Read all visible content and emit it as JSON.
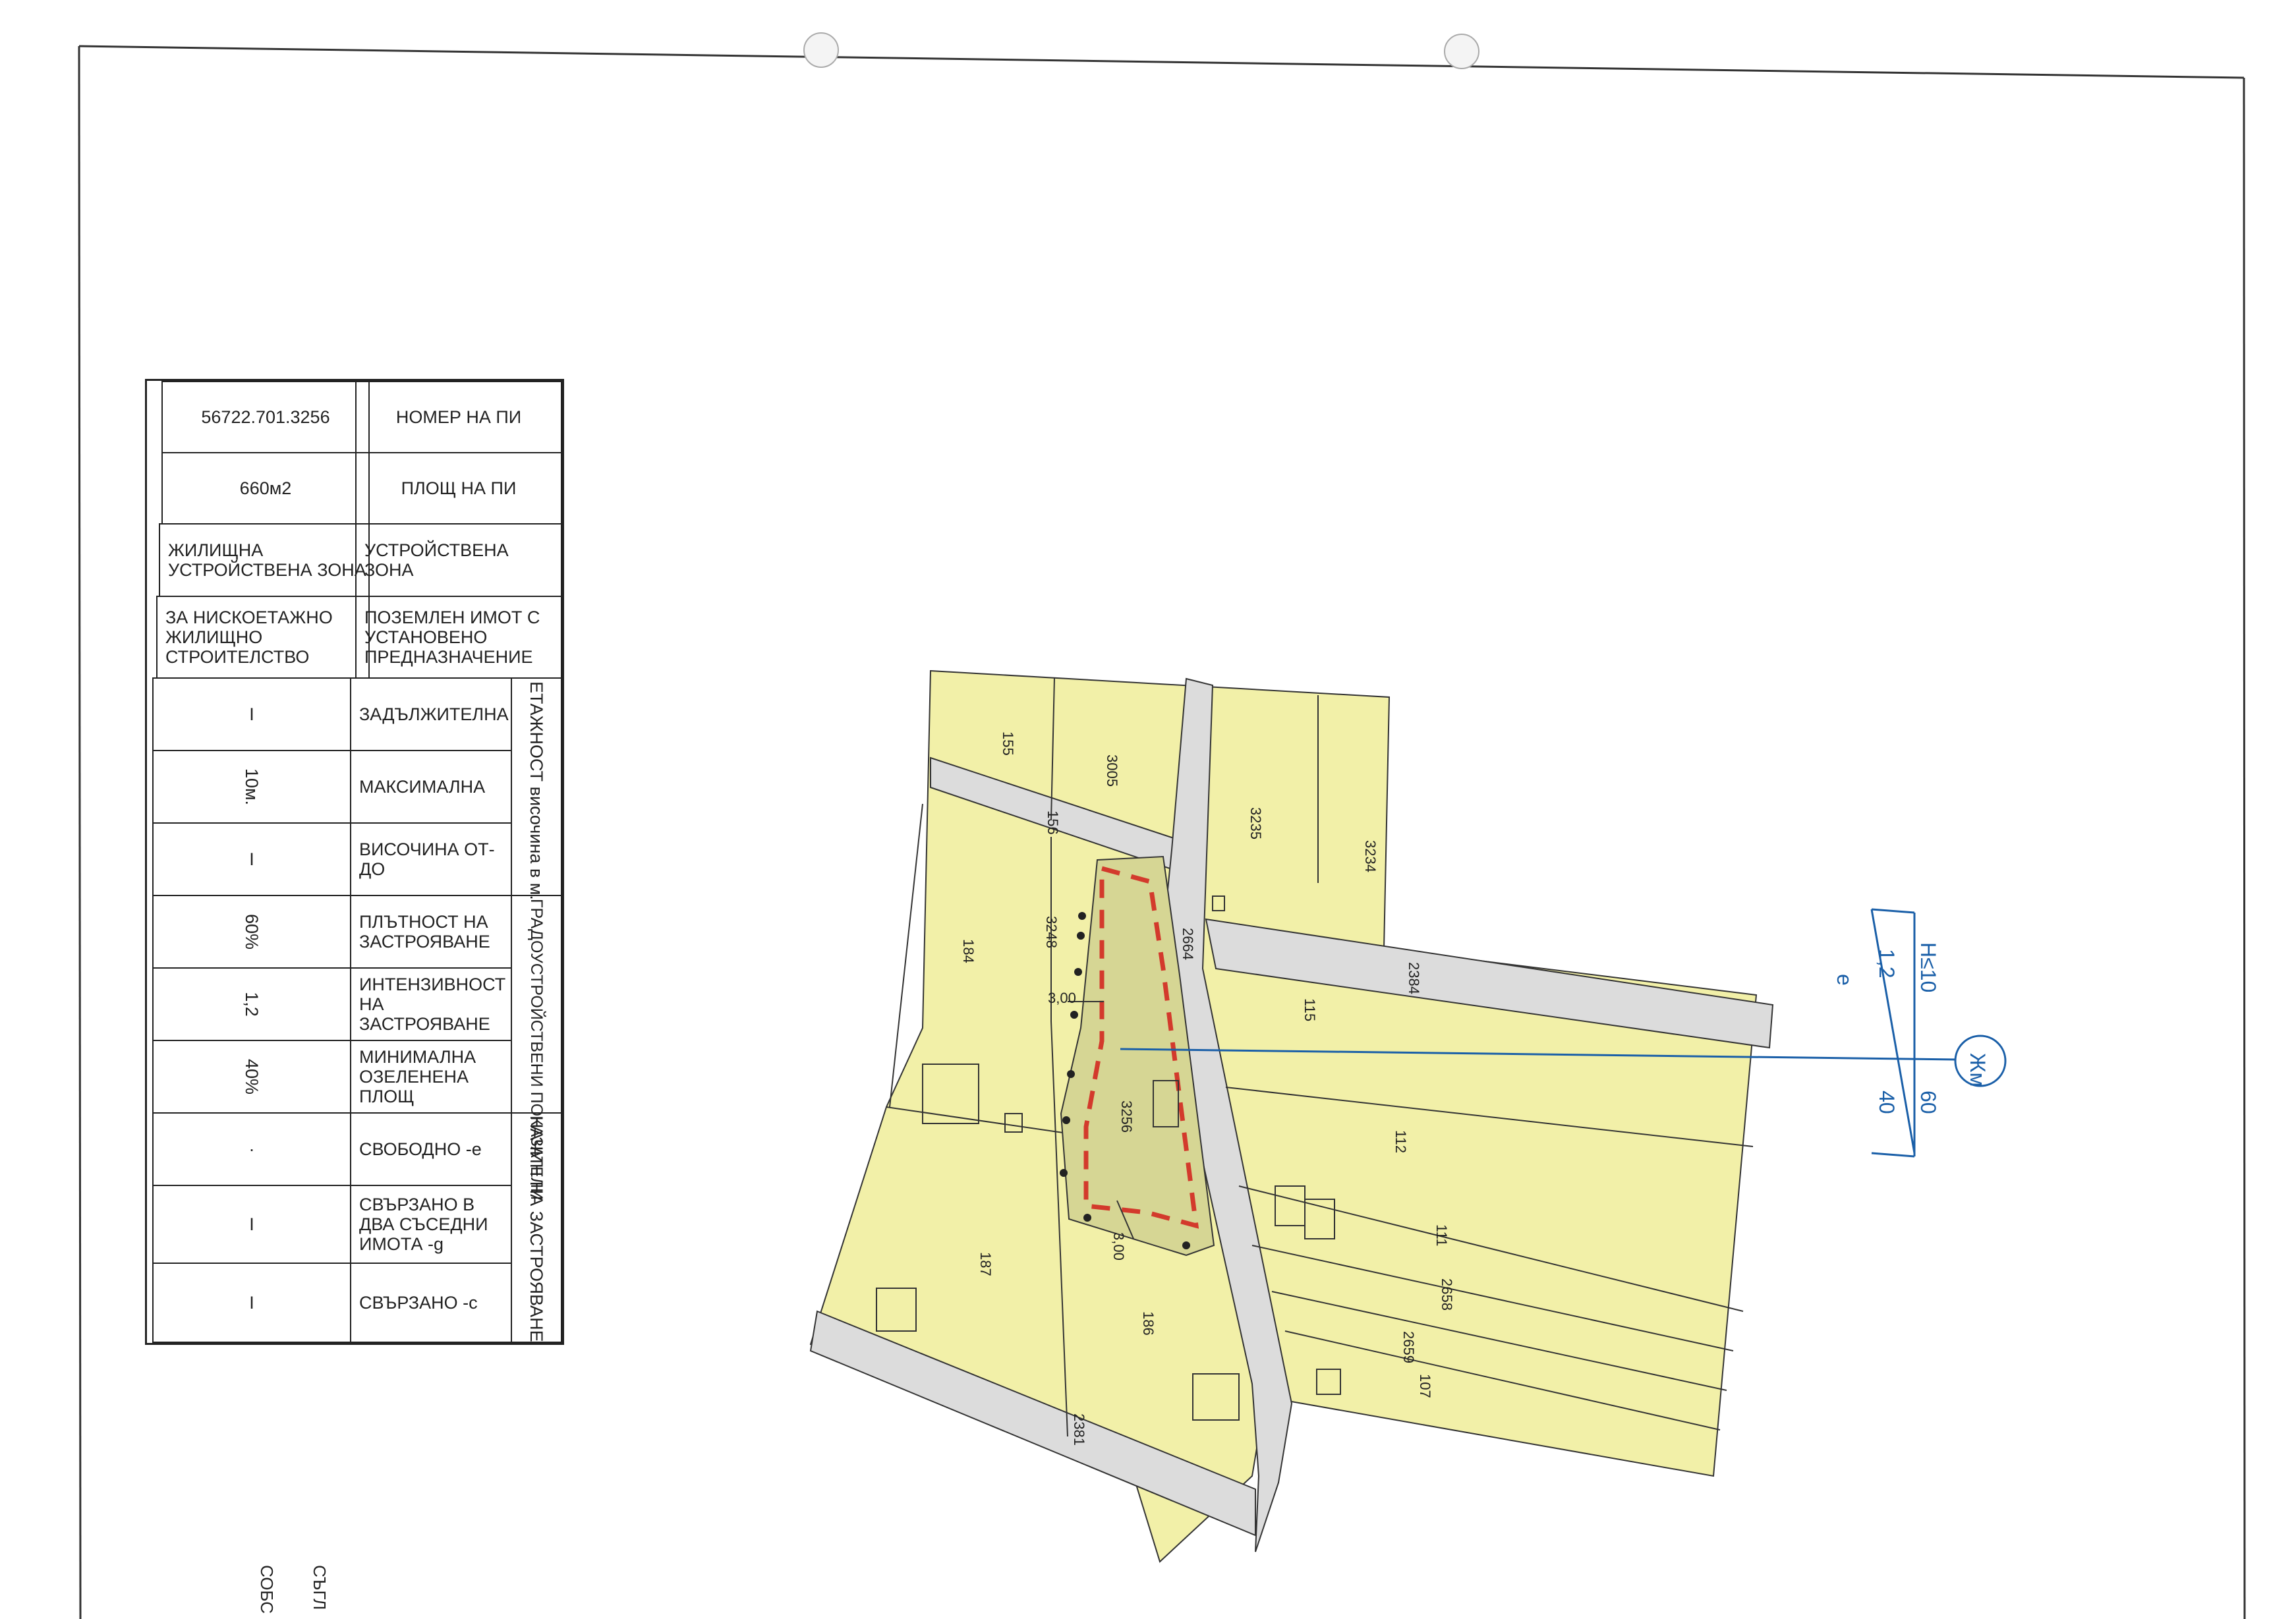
{
  "table": {
    "rows": [
      {
        "value": "56722.701.3256",
        "label": "НОМЕР НА ПИ"
      },
      {
        "value": "660м2",
        "label": "ПЛОЩ НА ПИ"
      },
      {
        "value": "ЖИЛИЩНА УСТРОЙСТВЕНА ЗОНА",
        "label": "УСТРОЙСТВЕНА ЗОНА"
      },
      {
        "value": "ЗА НИСКОЕТАЖНО ЖИЛИЩНО СТРОИТЕЛСТВО",
        "label": "ПОЗЕМЛЕН ИМОТ С УСТАНОВЕНО ПРЕДНАЗНАЧЕНИЕ"
      }
    ],
    "group_floor": "ЕТАЖНОСТ височина в м.",
    "group_indicators": "ГРАДОУСТРОЙСТВЕНИ ПОКАЗАТЕЛИ",
    "group_mode": "НАЧИН НА ЗАСТРОЯВАНЕ",
    "params": [
      {
        "value": "I",
        "label": "ЗАДЪЛЖИТЕЛНА"
      },
      {
        "value": "10м.",
        "label": "МАКСИМАЛНА"
      },
      {
        "value": "I",
        "label": "ВИСОЧИНА ОТ-ДО"
      },
      {
        "value": "60%",
        "label": "ПЛЪТНОСТ НА ЗАСТРОЯВАНЕ"
      },
      {
        "value": "1,2",
        "label": "ИНТЕНЗИВНОСТ НА ЗАСТРОЯВАНЕ"
      },
      {
        "value": "40%",
        "label": "МИНИМАЛНА ОЗЕЛЕНЕНА ПЛОЩ"
      },
      {
        "value": "·",
        "label": "СВОБОДНО -е"
      },
      {
        "value": "I",
        "label": "СВЪРЗАНО В ДВА СЪСЕДНИ ИМОТА -g"
      },
      {
        "value": "I",
        "label": "СВЪРЗАНО -с"
      }
    ]
  },
  "map": {
    "parcels": [
      "155",
      "3005",
      "3235",
      "3234",
      "156",
      "3248",
      "184",
      "2664",
      "2384",
      "115",
      "3256",
      "112",
      "111",
      "2658",
      "2659",
      "107",
      "187",
      "186",
      "2381"
    ],
    "dim1": "3,00",
    "dim2": "3,00",
    "colors": {
      "parcel": "#f2f0a8",
      "street": "#dcdcdc",
      "subject": "#d6d694",
      "boundary": "#d33a2c",
      "line": "#1a5fa8"
    }
  },
  "zone": {
    "code": "Жм",
    "h": "H≤10",
    "density": "60",
    "intensity": "1,2",
    "green": "40",
    "mode": "е"
  },
  "footer": {
    "text1": "СЪГЛ",
    "text2": "СОБС"
  }
}
